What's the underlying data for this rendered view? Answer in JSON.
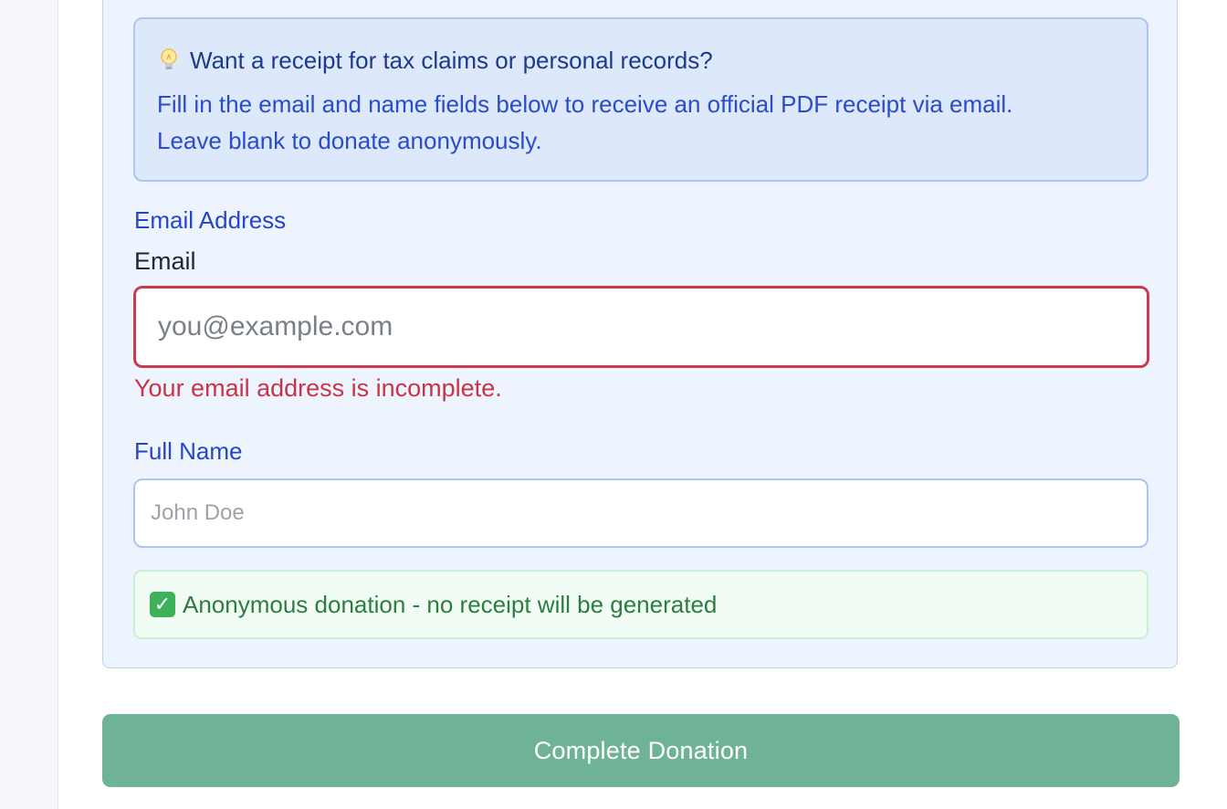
{
  "receipt_info": {
    "icon": "lightbulb-icon",
    "title": "Want a receipt for tax claims or personal records?",
    "line1": "Fill in the email and name fields below to receive an official PDF receipt via email.",
    "line2": "Leave blank to donate anonymously."
  },
  "email_section": {
    "section_label": "Email Address",
    "field_label": "Email",
    "value": "",
    "placeholder": "you@example.com",
    "error": "Your email address is incomplete.",
    "border_color": "#c73c4e"
  },
  "name_section": {
    "label": "Full Name",
    "value": "",
    "placeholder": "John Doe"
  },
  "status": {
    "icon": "check-mark-icon",
    "text": "Anonymous donation - no receipt will be generated"
  },
  "submit": {
    "label": "Complete Donation",
    "color": "#6eb397"
  }
}
